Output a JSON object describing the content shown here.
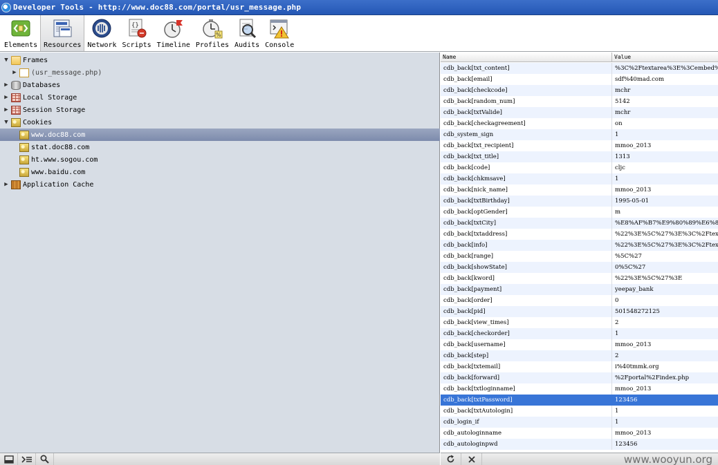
{
  "window": {
    "title": "Developer Tools - http://www.doc88.com/portal/usr_message.php"
  },
  "toolbar": {
    "tabs": [
      {
        "label": "Elements",
        "icon": "elements-icon"
      },
      {
        "label": "Resources",
        "icon": "resources-icon",
        "active": true
      },
      {
        "label": "Network",
        "icon": "network-icon"
      },
      {
        "label": "Scripts",
        "icon": "scripts-icon"
      },
      {
        "label": "Timeline",
        "icon": "timeline-icon"
      },
      {
        "label": "Profiles",
        "icon": "profiles-icon"
      },
      {
        "label": "Audits",
        "icon": "audits-icon"
      },
      {
        "label": "Console",
        "icon": "console-icon"
      }
    ]
  },
  "tree": {
    "frames": {
      "label": "Frames",
      "child": "(usr_message.php)"
    },
    "databases": "Databases",
    "local_storage": "Local Storage",
    "session_storage": "Session Storage",
    "cookies": {
      "label": "Cookies",
      "items": [
        "www.doc88.com",
        "stat.doc88.com",
        "ht.www.sogou.com",
        "www.baidu.com"
      ],
      "selected_index": 0
    },
    "app_cache": "Application Cache"
  },
  "table": {
    "columns": [
      "Name",
      "Value"
    ],
    "selected_index": 30,
    "rows": [
      [
        "cdb_back[txt_content]",
        "%3C%2Ftextarea%3E%3Cembed%2Fsr"
      ],
      [
        "cdb_back[email]",
        "sdf%40mad.com"
      ],
      [
        "cdb_back[checkcode]",
        "mchr"
      ],
      [
        "cdb_back[random_num]",
        "5142"
      ],
      [
        "cdb_back[txtValide]",
        "mchr"
      ],
      [
        "cdb_back[checkagreement]",
        "on"
      ],
      [
        "cdb_system_sign",
        "1"
      ],
      [
        "cdb_back[txt_recipient]",
        "mmoo_2013"
      ],
      [
        "cdb_back[txt_title]",
        "1313"
      ],
      [
        "cdb_back[code]",
        "cljc"
      ],
      [
        "cdb_back[chkmsave]",
        "1"
      ],
      [
        "cdb_back[nick_name]",
        "mmoo_2013"
      ],
      [
        "cdb_back[txtBirthday]",
        "1995-05-01"
      ],
      [
        "cdb_back[optGender]",
        "m"
      ],
      [
        "cdb_back[txtCity]",
        "%E8%AF%B7%E9%80%89%E6%8B%A9"
      ],
      [
        "cdb_back[txtaddress]",
        "%22%3E%5C%27%3E%3C%2Ftextarea%"
      ],
      [
        "cdb_back[info]",
        "%22%3E%5C%27%3E%3C%2Ftextarea%"
      ],
      [
        "cdb_back[range]",
        "%5C%27"
      ],
      [
        "cdb_back[showState]",
        "0%5C%27"
      ],
      [
        "cdb_back[kword]",
        "%22%3E%5C%27%3E"
      ],
      [
        "cdb_back[payment]",
        "yeepay_bank"
      ],
      [
        "cdb_back[order]",
        "0"
      ],
      [
        "cdb_back[pid]",
        "501548272125"
      ],
      [
        "cdb_back[view_times]",
        "2"
      ],
      [
        "cdb_back[checkorder]",
        "1"
      ],
      [
        "cdb_back[username]",
        "mmoo_2013"
      ],
      [
        "cdb_back[step]",
        "2"
      ],
      [
        "cdb_back[txtemail]",
        "i%40tmmk.org"
      ],
      [
        "cdb_back[forward]",
        "%2Fportal%2Findex.php"
      ],
      [
        "cdb_back[txtloginname]",
        "mmoo_2013"
      ],
      [
        "cdb_back[txtPassword]",
        "123456"
      ],
      [
        "cdb_back[txtAutologin]",
        "1"
      ],
      [
        "cdb_login_if",
        "1"
      ],
      [
        "cdb_autologinname",
        "mmoo_2013"
      ],
      [
        "cdb_autologinpwd",
        "123456"
      ]
    ]
  },
  "status": {
    "left_buttons": [
      "dock-icon",
      "console-toggle-icon",
      "search-icon"
    ],
    "right_buttons": [
      "refresh-icon",
      "delete-icon"
    ],
    "watermark": "www.wooyun.org"
  }
}
